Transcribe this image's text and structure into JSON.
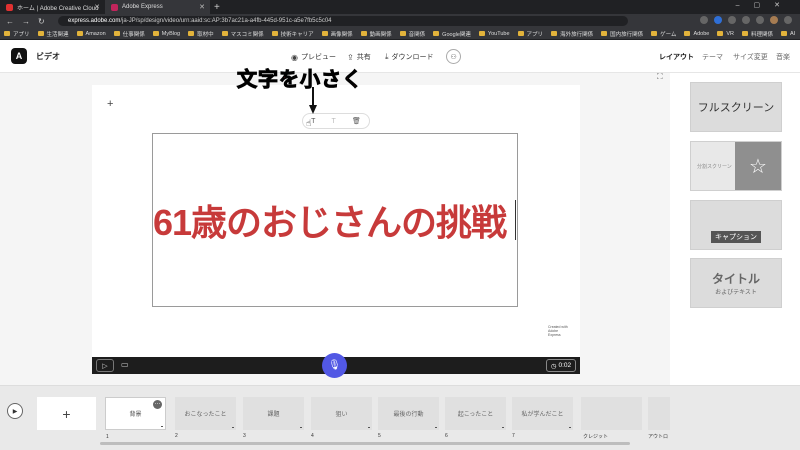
{
  "browser": {
    "tabs": [
      {
        "title": "ホーム | Adobe Creative Cloud",
        "color": "#e03131"
      },
      {
        "title": "Adobe Express",
        "color": "#c2255c"
      }
    ],
    "url_host": "express.adobe.com",
    "url_path": "/ja-JP/sp/design/video/urn:aaid:sc:AP:3b7ac21a-a4fb-445d-951c-a5e7fb5c5c04",
    "bookmarks": [
      "アプリ",
      "生活関連",
      "Amazon",
      "仕事関係",
      "MyBlog",
      "取材中",
      "マスコミ関係",
      "技術キャリア",
      "画像関係",
      "動画関係",
      "音関係",
      "Google関連",
      "YouTube",
      "アプリ",
      "海外旅行関係",
      "国内旅行関係",
      "ゲーム",
      "Adobe",
      "VR",
      "料理関係",
      "AI"
    ]
  },
  "app": {
    "logo": "A",
    "title": "ビデオ",
    "preview_label": "プレビュー",
    "share_label": "共有",
    "download_label": "ダウンロード",
    "right_tabs": [
      "レイアウト",
      "テーマ",
      "サイズ変更",
      "音楽"
    ]
  },
  "stage": {
    "main_text": "61歳のおじさんの挑戦",
    "annotation": "文字を小さく",
    "timer": "0:02",
    "watermark": "Created with Adobe Express"
  },
  "layouts": {
    "fullscreen": "フルスクリーン",
    "split": "分割スクリーン",
    "caption": "キャプション",
    "title": "タイトル",
    "title_sub": "およびテキスト"
  },
  "scenes": [
    {
      "label": "背景",
      "num": "1"
    },
    {
      "label": "おこなったこと",
      "num": "2"
    },
    {
      "label": "課題",
      "num": "3"
    },
    {
      "label": "狙い",
      "num": "4"
    },
    {
      "label": "最後の行動",
      "num": "5"
    },
    {
      "label": "起こったこと",
      "num": "6"
    },
    {
      "label": "私が学んだこと",
      "num": "7"
    },
    {
      "label": "",
      "num": "クレジット"
    },
    {
      "label": "",
      "num": "アウトロ"
    }
  ]
}
